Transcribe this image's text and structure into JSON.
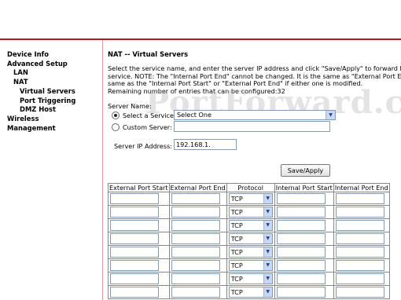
{
  "nav": {
    "items": [
      {
        "label": "Device Info"
      },
      {
        "label": "Advanced Setup"
      },
      {
        "label": "LAN"
      },
      {
        "label": "NAT"
      },
      {
        "label": "Virtual Servers"
      },
      {
        "label": "Port Triggering"
      },
      {
        "label": "DMZ Host"
      },
      {
        "label": "Wireless"
      },
      {
        "label": "Management"
      }
    ]
  },
  "main": {
    "title": "NAT -- Virtual Servers",
    "desc_line1": "Select the service name, and enter the server IP address and click \"Save/Apply\" to forward IP packets",
    "desc_line2": "service. NOTE: The \"Internal Port End\" cannot be changed. It is the same as \"External Port End\"",
    "desc_line3": "same as the \"Internal Port Start\" or \"External Port End\" if either one is modified.",
    "desc_line4": "Remaining number of entries that can be configured:32",
    "server_name_label": "Server Name:",
    "select_service_label": "Select a Service:",
    "select_service_value": "Select One",
    "custom_server_label": "Custom Server:",
    "server_ip_label": "Server IP Address:",
    "server_ip_value": "192.168.1.",
    "save_apply": "Save/Apply",
    "watermark": "PortForward.com"
  },
  "table": {
    "headers": [
      "External Port Start",
      "External Port End",
      "Protocol",
      "Internal Port Start",
      "Internal Port End"
    ],
    "rows": [
      {
        "protocol": "TCP"
      },
      {
        "protocol": "TCP"
      },
      {
        "protocol": "TCP"
      },
      {
        "protocol": "TCP"
      },
      {
        "protocol": "TCP"
      },
      {
        "protocol": "TCP"
      },
      {
        "protocol": "TCP"
      },
      {
        "protocol": "TCP"
      }
    ]
  },
  "colors": {
    "accent_red": "#b01c1c",
    "select_arrow": "#c8d8f4"
  }
}
